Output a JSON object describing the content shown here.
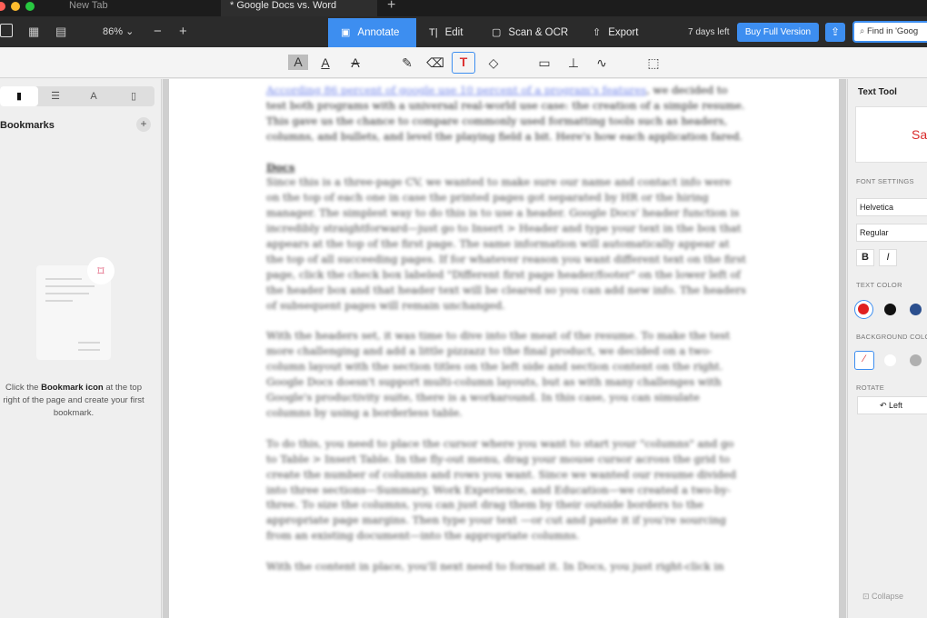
{
  "tabs": [
    {
      "label": "New Tab"
    },
    {
      "label": "* Google Docs vs. Word"
    }
  ],
  "colors": {
    "accent": "#3d8ef0",
    "toolbar_bg": "#2b2b2b",
    "tabbar_bg": "#1c1c1c"
  },
  "toolbar": {
    "zoom": "86%",
    "modes": [
      {
        "label": "Annotate",
        "icon": "annotate-icon",
        "active": true
      },
      {
        "label": "Edit",
        "icon": "text-cursor-icon",
        "active": false
      },
      {
        "label": "Scan & OCR",
        "icon": "scan-icon",
        "active": false
      },
      {
        "label": "Export",
        "icon": "export-icon",
        "active": false
      }
    ],
    "trial": "7 days left",
    "buy_label": "Buy Full Version",
    "find_placeholder": "Find in 'Goog"
  },
  "annotate_tools": [
    {
      "name": "highlight-text-icon",
      "glyph": "A"
    },
    {
      "name": "underline-text-icon",
      "glyph": "A"
    },
    {
      "name": "strikethrough-text-icon",
      "glyph": "A"
    },
    {
      "name": "pen-icon",
      "glyph": "✎"
    },
    {
      "name": "eraser-icon",
      "glyph": "⌫"
    },
    {
      "name": "text-box-icon",
      "glyph": "T"
    },
    {
      "name": "shape-icon",
      "glyph": "◇"
    },
    {
      "name": "comment-icon",
      "glyph": "▭"
    },
    {
      "name": "stamp-icon",
      "glyph": "⊥"
    },
    {
      "name": "signature-icon",
      "glyph": "∿"
    },
    {
      "name": "area-select-icon",
      "glyph": "⬚"
    }
  ],
  "sidebar": {
    "tabs": [
      {
        "name": "bookmark-tab",
        "glyph": "▮"
      },
      {
        "name": "outline-tab",
        "glyph": "☰"
      },
      {
        "name": "annotations-tab",
        "glyph": "A"
      },
      {
        "name": "page-thumbnail-tab",
        "glyph": "▯"
      }
    ],
    "title": "Bookmarks",
    "add": "+",
    "empty_pre": "Click the ",
    "empty_bold": "Bookmark icon",
    "empty_post": " at the top right of the page and create your first bookmark."
  },
  "document": {
    "first_link": "According 86 percent of google use 10 percent of a program's features",
    "first_rest": ", we decided to test both programs with a universal real-world use case: the creation of a simple resume. This gave us the chance to compare commonly used formatting tools such as headers, columns, and bullets, and level the playing field a bit. Here's how each application fared.",
    "heading": "Docs",
    "paragraphs": [
      "Since this is a three-page CV, we wanted to make sure our name and contact info were on the top of each one in case the printed pages got separated by HR or the hiring manager. The simplest way to do this is to use a header. Google Docs' header function is incredibly straightforward—just go to Insert > Header and type your text in the box that appears at the top of the first page. The same information will automatically appear at the top of all succeeding pages. If for whatever reason you want different text on the first page, click the check box labeled \"Different first page header/footer\" on the lower left of the header box and that header text will be cleared so you can add new info. The headers of subsequent pages will remain unchanged.",
      "With the headers set, it was time to dive into the meat of the resume. To make the test more challenging and add a little pizzazz to the final product, we decided on a two-column layout with the section titles on the left side and section content on the right. Google Docs doesn't support multi-column layouts, but as with many challenges with Google's productivity suite, there is a workaround. In this case, you can simulate columns by using a borderless table.",
      "To do this, you need to place the cursor where you want to start your \"columns\" and go to Table > Insert Table. In the fly-out menu, drag your mouse cursor across the grid to create the number of columns and rows you want. Since we wanted our resume divided into three sections—Summary, Work Experience, and Education—we created a two-by-three. To size the columns, you can just drag them by their outside borders to the appropriate page margins. Then type your text —or cut and paste it if you're sourcing from an existing document—into the appropriate columns.",
      "With the content in place, you'll next need to format it. In Docs, you just right-click in"
    ]
  },
  "right_panel": {
    "title": "Text Tool",
    "preview": "Sa",
    "font_settings_label": "FONT SETTINGS",
    "font": "Helvetica",
    "style": "Regular",
    "bold": "B",
    "italic": "I",
    "text_color_label": "TEXT COLOR",
    "text_colors": [
      "#e02020",
      "#111111",
      "#2b4f8e"
    ],
    "bg_color_label": "BACKGROUND COLO",
    "bg_colors": [
      "none",
      "#ffffff",
      "#b0b0b0",
      "#777777"
    ],
    "rotate_label": "ROTATE",
    "rotate_value": "Left",
    "collapse": "Collapse"
  }
}
